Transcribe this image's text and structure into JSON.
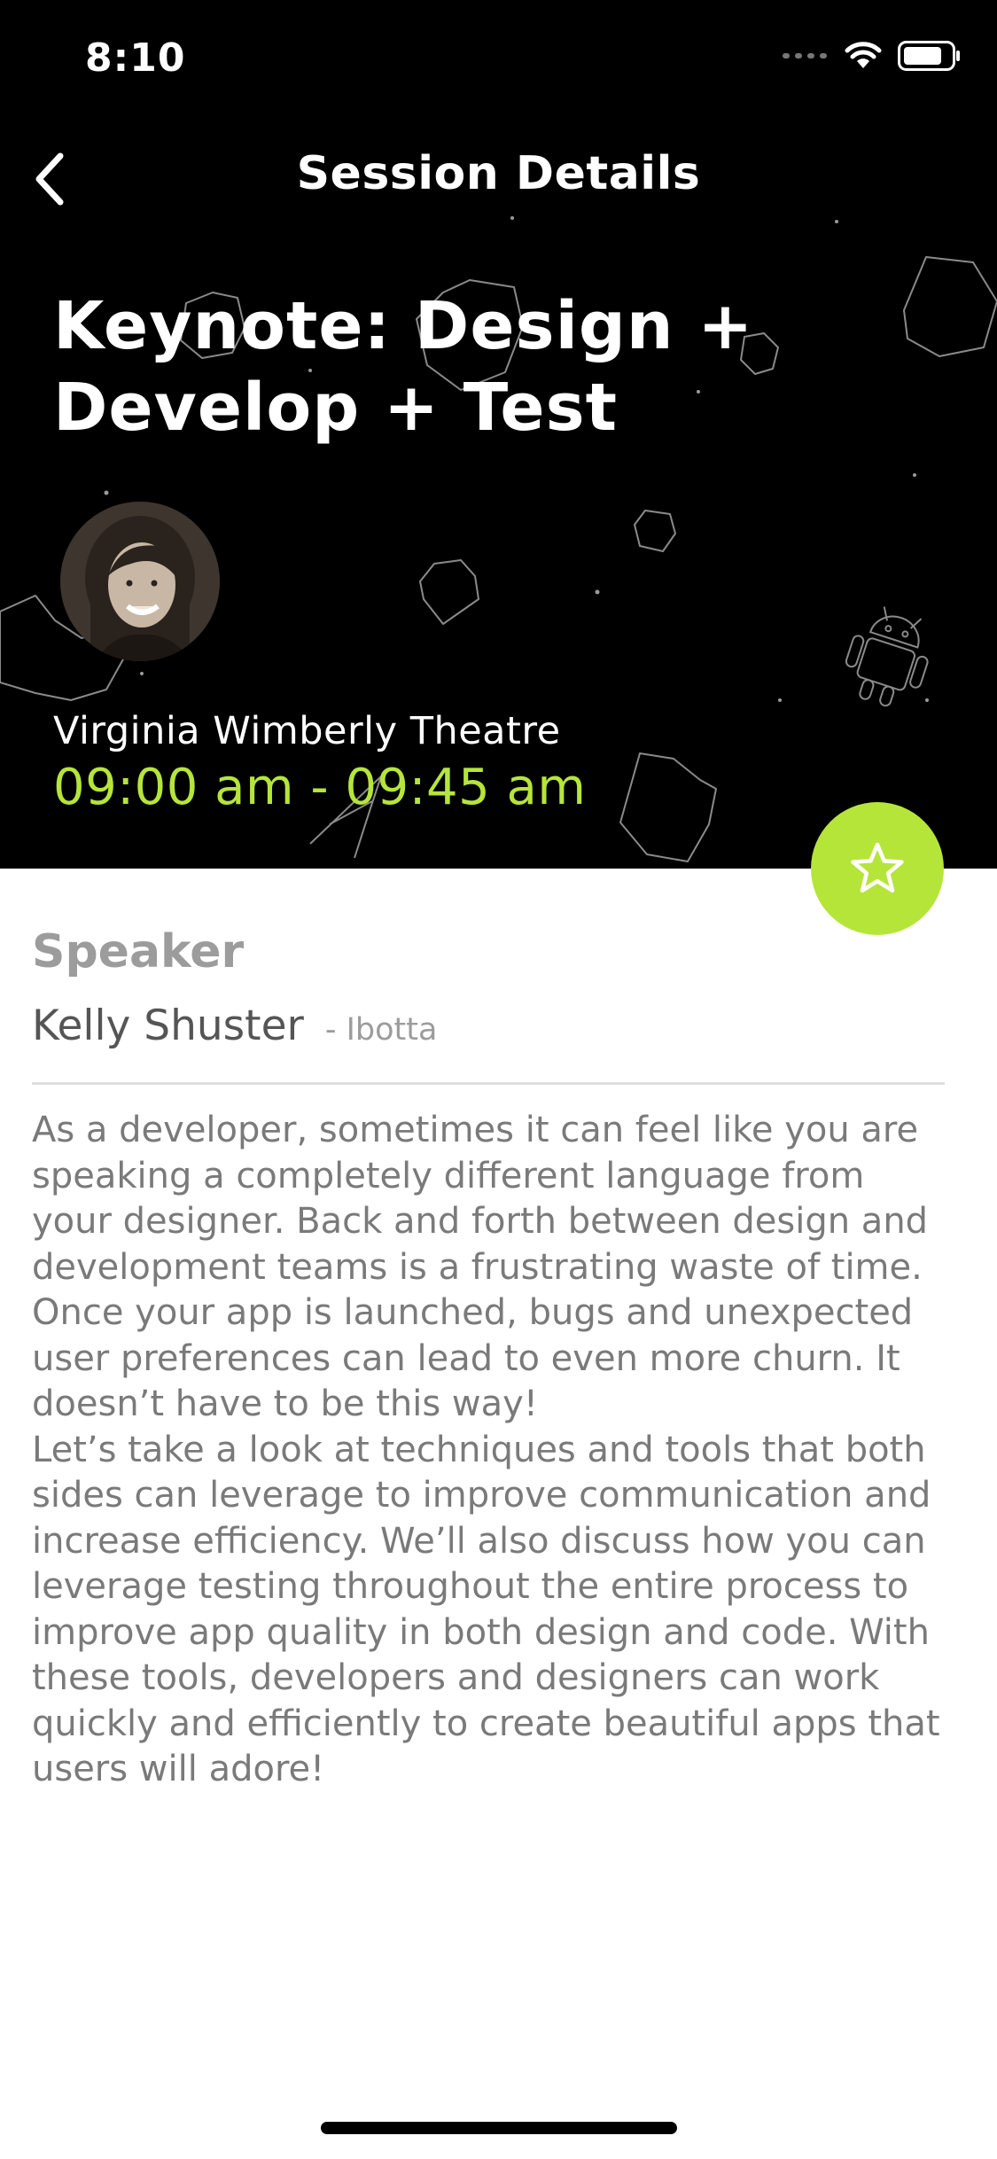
{
  "status_bar": {
    "time": "8:10",
    "icons": [
      "signal-dots-icon",
      "wifi-icon",
      "battery-icon"
    ]
  },
  "nav": {
    "back_icon": "chevron-left-icon",
    "title": "Session Details"
  },
  "session": {
    "title": "Keynote: Design + Develop + Test",
    "room": "Virginia Wimberly Theatre",
    "time_range": "09:00 am - 09:45 am",
    "favorite_icon": "star-outline-icon"
  },
  "speaker_section": {
    "heading": "Speaker",
    "name": "Kelly Shuster",
    "company": "- Ibotta"
  },
  "description": "As a developer, sometimes it can feel like you are speaking a completely different language from your designer. Back and forth between design and development teams is a frustrating waste of time. Once your app is launched, bugs and unexpected user preferences can lead to even more churn. It doesn’t have to be this way!\nLet’s take a look at techniques and tools that both sides can leverage to improve communication and increase efficiency. We’ll also discuss how you can leverage testing throughout the entire process to improve app quality in both design and code. With these tools, developers and designers can work quickly and efficiently to create beautiful apps that users will adore!",
  "colors": {
    "accent": "#b6e53a",
    "hero_background": "#000000",
    "heading_gray": "#9c9c9c",
    "body_gray": "#7a7a7a"
  }
}
